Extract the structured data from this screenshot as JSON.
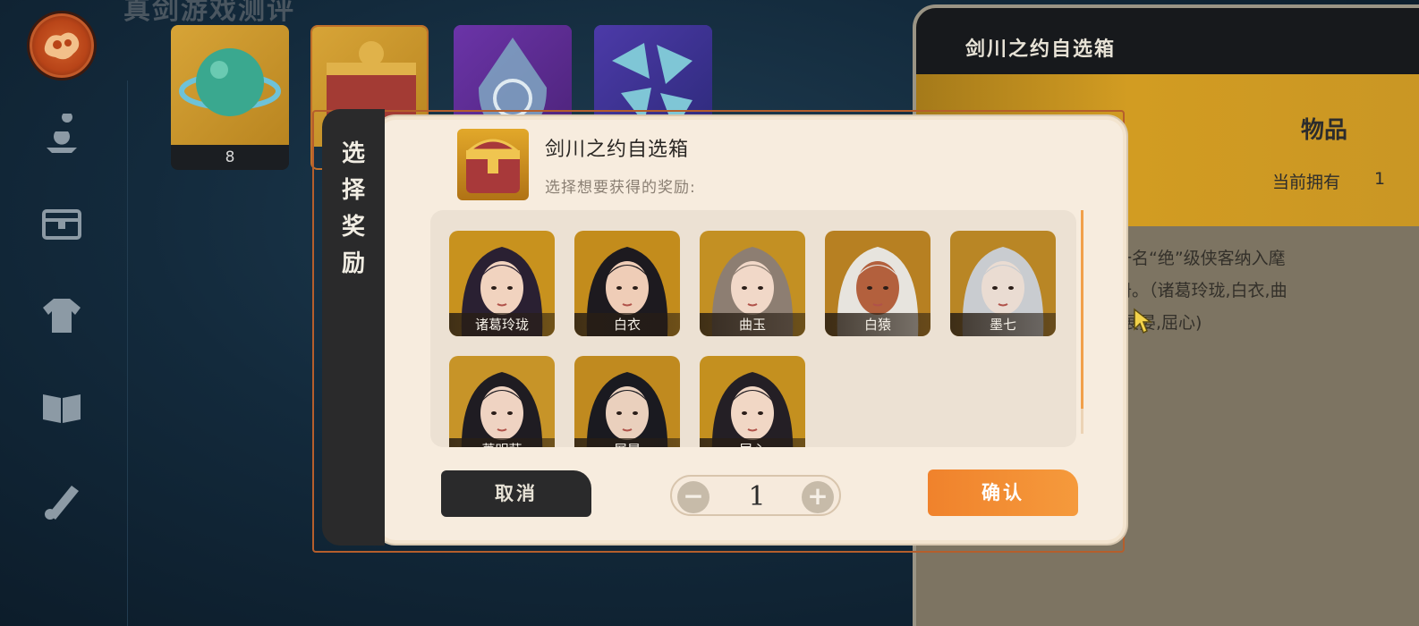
{
  "page": {
    "top_title": "真剑游戏测评"
  },
  "sidebar": {
    "items": [
      {
        "icon": "gourd-icon"
      },
      {
        "icon": "chest-icon"
      },
      {
        "icon": "robe-icon"
      },
      {
        "icon": "book-icon"
      },
      {
        "icon": "scroll-icon"
      }
    ]
  },
  "inventory": {
    "slots": [
      {
        "icon": "jade-orb-icon",
        "count": "8"
      },
      {
        "icon": "treasure-chest-icon",
        "count": ""
      },
      {
        "icon": "purple-crystal-icon",
        "count": ""
      },
      {
        "icon": "blue-shards-icon",
        "count": ""
      }
    ]
  },
  "detail_panel": {
    "title": "剑川之约自选箱",
    "type_label": "物品",
    "owned_label": "当前拥有",
    "owned_value": "1",
    "description_lines": [
      "一名“绝”级侠客纳入麾",
      "册。（诸葛玲珑,白衣,曲",
      "展晏,屈心)"
    ]
  },
  "dialog": {
    "side_tab": [
      "选",
      "择",
      "奖",
      "励"
    ],
    "item_name": "剑川之约自选箱",
    "subtitle": "选择想要获得的奖励:",
    "heroes": [
      {
        "name": "诸葛玲珑",
        "hair": "#2a2032",
        "skin": "#f1d3bf",
        "bg": "#c8921e"
      },
      {
        "name": "白衣",
        "hair": "#1d1a1f",
        "skin": "#efcdb7",
        "bg": "#c38c1c"
      },
      {
        "name": "曲玉",
        "hair": "#8d7e72",
        "skin": "#f1d8c8",
        "bg": "#c39023"
      },
      {
        "name": "白猿",
        "hair": "#e7e4de",
        "skin": "#b3603d",
        "bg": "#b78022"
      },
      {
        "name": "墨七",
        "hair": "#c9ccd0",
        "skin": "#eadcd2",
        "bg": "#b98625"
      },
      {
        "name": "萧明荪",
        "hair": "#1f1c22",
        "skin": "#efd3c2",
        "bg": "#c79428"
      },
      {
        "name": "展晏",
        "hair": "#1a1a20",
        "skin": "#ead0bd",
        "bg": "#c08a1f"
      },
      {
        "name": "屈心",
        "hair": "#241f25",
        "skin": "#f1d7c5",
        "bg": "#c4901f"
      }
    ],
    "cancel_label": "取消",
    "quantity": "1",
    "minus_label": "−",
    "plus_label": "+",
    "confirm_label": "确认"
  }
}
